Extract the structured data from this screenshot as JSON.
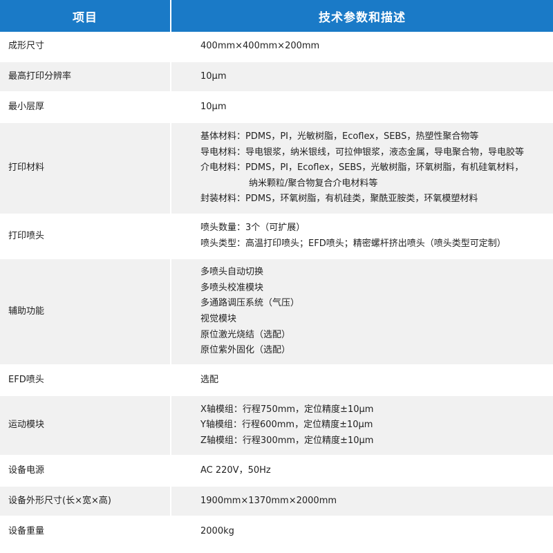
{
  "header": {
    "col1": "项目",
    "col2": "技术参数和描述"
  },
  "rows": [
    {
      "name": "成形尺寸",
      "lines": [
        "400mm×400mm×200mm"
      ]
    },
    {
      "name": "最高打印分辨率",
      "lines": [
        "10μm"
      ]
    },
    {
      "name": "最小层厚",
      "lines": [
        "10μm"
      ]
    },
    {
      "name": "打印材料",
      "lines": [
        "基体材料：PDMS，PI，光敏树脂，Ecoflex，SEBS，热塑性聚合物等",
        "导电材料：导电银浆，纳米银线，可拉伸银浆，液态金属，导电聚合物，导电胶等",
        "介电材料：PDMS，PI，Ecoflex，SEBS，光敏树脂，环氧树脂，有机硅氧材料，",
        "纳米颗粒/聚合物复合介电材料等",
        "封装材料：PDMS，环氧树脂，有机硅类，聚酰亚胺类，环氧模塑材料"
      ]
    },
    {
      "name": "打印喷头",
      "lines": [
        "喷头数量：3个（可扩展）",
        "喷头类型：高温打印喷头；EFD喷头；精密螺杆挤出喷头（喷头类型可定制）"
      ]
    },
    {
      "name": "辅助功能",
      "lines": [
        "多喷头自动切换",
        "多喷头校准模块",
        "多通路调压系统（气压）",
        "视觉模块",
        "原位激光烧结（选配）",
        "原位紫外固化（选配）"
      ]
    },
    {
      "name": "EFD喷头",
      "lines": [
        "选配"
      ]
    },
    {
      "name": "运动模块",
      "lines": [
        "X轴模组：行程750mm，定位精度±10μm",
        "Y轴模组：行程600mm，定位精度±10μm",
        "Z轴模组：行程300mm，定位精度±10μm"
      ]
    },
    {
      "name": "设备电源",
      "lines": [
        "AC 220V，50Hz"
      ]
    },
    {
      "name": "设备外形尺寸(长×宽×高)",
      "lines": [
        "1900mm×1370mm×2000mm"
      ]
    },
    {
      "name": "设备重量",
      "lines": [
        "2000kg"
      ]
    }
  ]
}
